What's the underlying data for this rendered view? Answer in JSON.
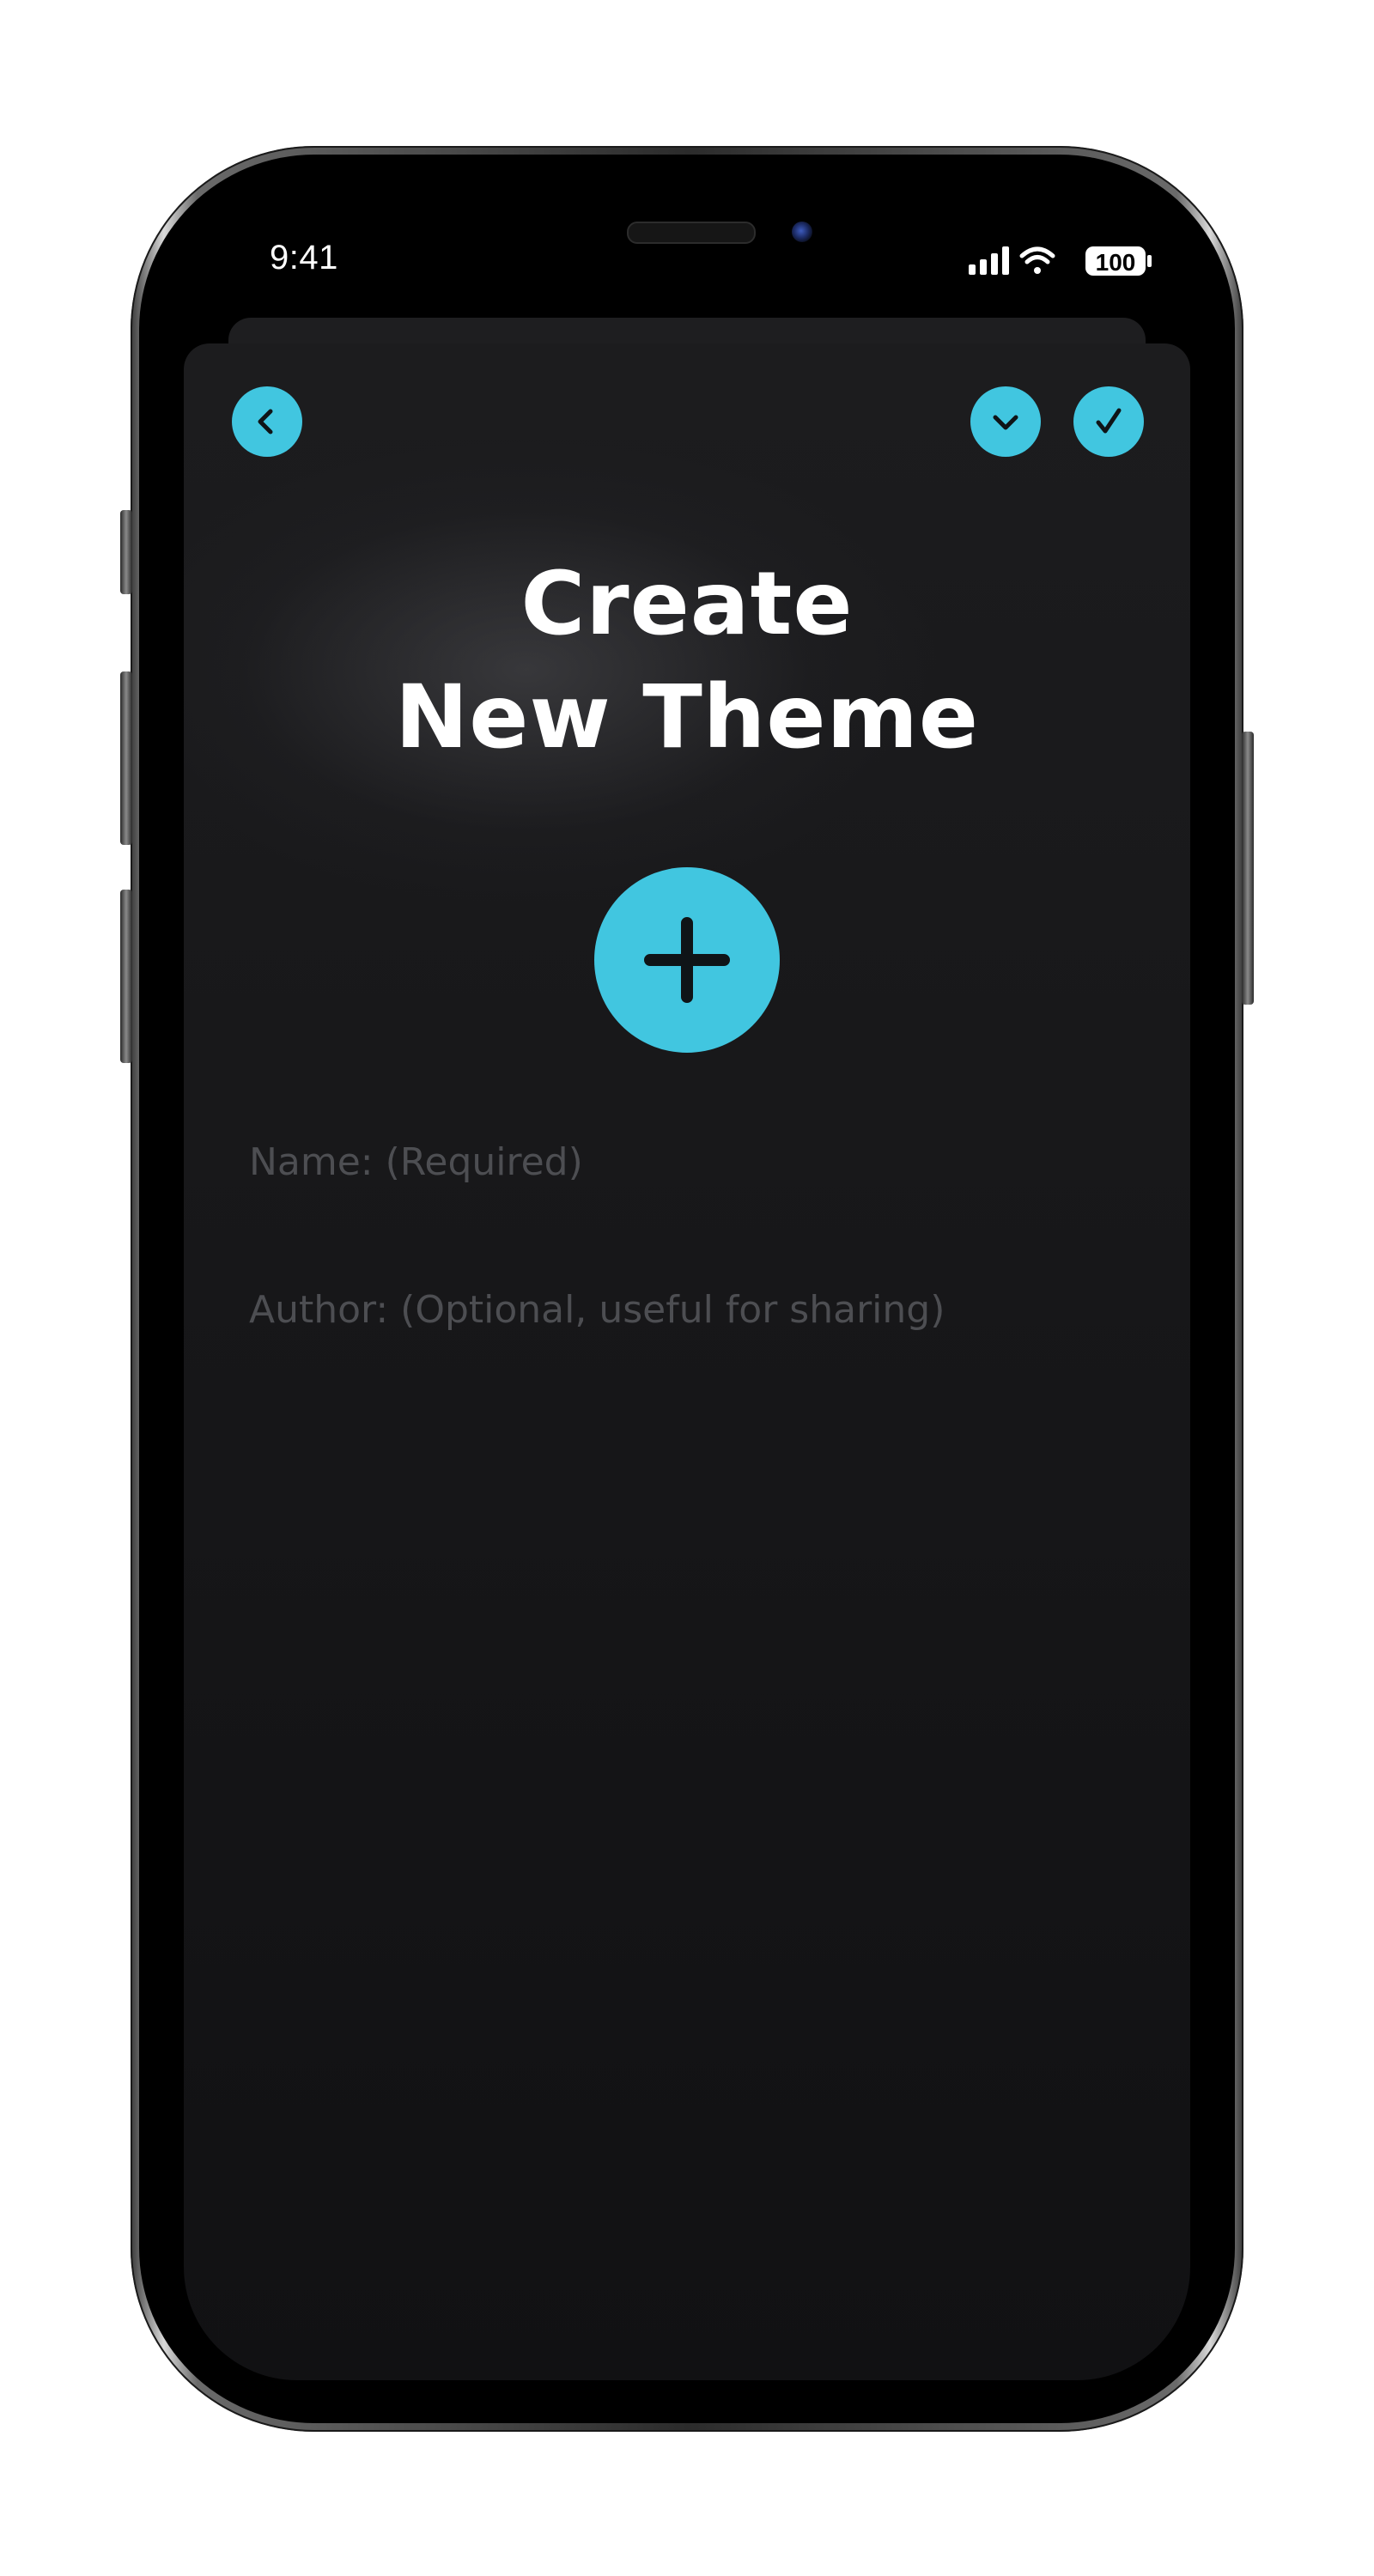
{
  "status_bar": {
    "time": "9:41",
    "battery": "100",
    "signal_icon": "cellular-signal-icon",
    "wifi_icon": "wifi-icon",
    "battery_icon": "battery-icon"
  },
  "toolbar": {
    "back_icon": "chevron-left-icon",
    "collapse_icon": "chevron-down-icon",
    "confirm_icon": "checkmark-icon"
  },
  "screen": {
    "title_line1": "Create",
    "title_line2": "New Theme",
    "add_icon": "plus-icon"
  },
  "form": {
    "name_placeholder": "Name: (Required)",
    "name_value": "",
    "author_placeholder": "Author: (Optional, useful for sharing)",
    "author_value": ""
  },
  "colors": {
    "accent": "#41c6e0",
    "background": "#161618",
    "title_text": "#ffffff",
    "placeholder_text": "#4d4e52"
  }
}
